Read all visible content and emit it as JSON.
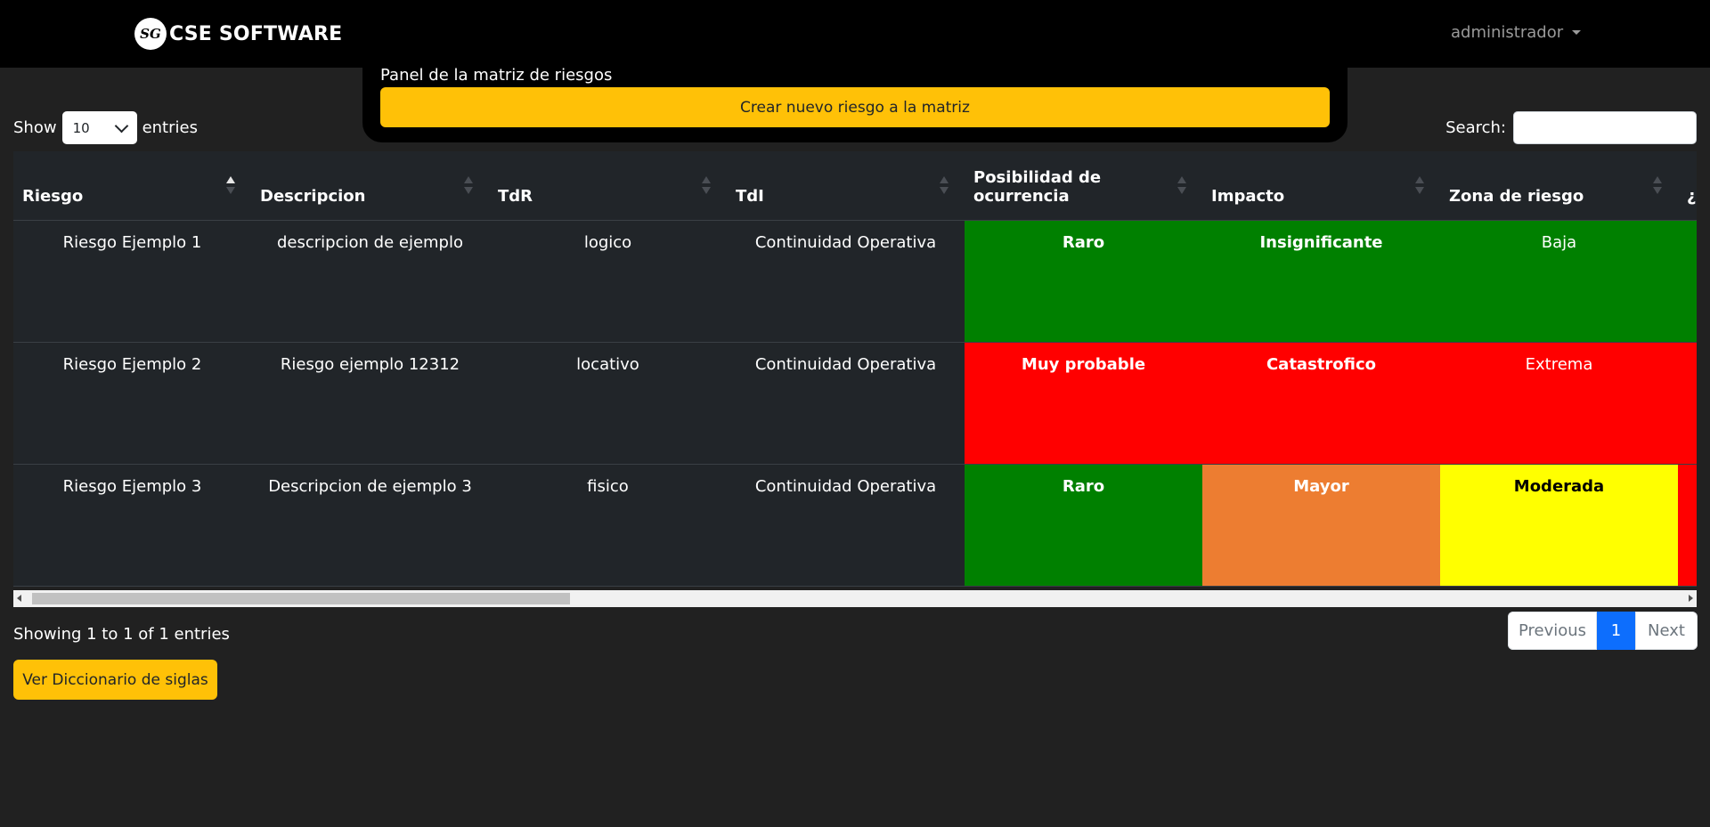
{
  "navbar": {
    "logo_mark": "SG",
    "brand": "CSE SOFTWARE",
    "user": "administrador"
  },
  "panel": {
    "title": "Panel de la matriz de riesgos",
    "create_button": "Crear nuevo riesgo a la matriz"
  },
  "length": {
    "show_label": "Show",
    "value": "10",
    "entries_label": "entries"
  },
  "search": {
    "label": "Search:",
    "value": ""
  },
  "table": {
    "columns": [
      "Riesgo",
      "Descripcion",
      "TdR",
      "TdI",
      "Posibilidad de ocurrencia",
      "Impacto",
      "Zona de riesgo",
      "¿"
    ],
    "sorted_column": "Riesgo",
    "rows": [
      {
        "riesgo": "Riesgo Ejemplo 1",
        "descripcion": "descripcion de ejemplo",
        "tdr": "logico",
        "tdi": "Continuidad Operativa",
        "posibilidad": "Raro",
        "posibilidad_color": "#008000",
        "impacto": "Insignificante",
        "impacto_color": "#008000",
        "zona": "Baja",
        "zona_color": "#008000",
        "zona_text_color": "#ffffff",
        "next_color": "#008000"
      },
      {
        "riesgo": "Riesgo Ejemplo 2",
        "descripcion": "Riesgo ejemplo 12312",
        "tdr": "locativo",
        "tdi": "Continuidad Operativa",
        "posibilidad": "Muy probable",
        "posibilidad_color": "#ff0000",
        "impacto": "Catastrofico",
        "impacto_color": "#ff0000",
        "zona": "Extrema",
        "zona_color": "#ff0000",
        "zona_text_color": "#ffffff",
        "next_color": "#ff0000"
      },
      {
        "riesgo": "Riesgo Ejemplo 3",
        "descripcion": "Descripcion de ejemplo 3",
        "tdr": "fisico",
        "tdi": "Continuidad Operativa",
        "posibilidad": "Raro",
        "posibilidad_color": "#008000",
        "impacto": "Mayor",
        "impacto_color": "#ed7d31",
        "zona": "Moderada",
        "zona_color": "#ffff00",
        "zona_text_color": "#000000",
        "next_color": "#ff0000"
      }
    ]
  },
  "info": "Showing 1 to 1 of 1 entries",
  "pagination": {
    "previous": "Previous",
    "current": "1",
    "next": "Next"
  },
  "dictionary_button": "Ver Diccionario de siglas"
}
